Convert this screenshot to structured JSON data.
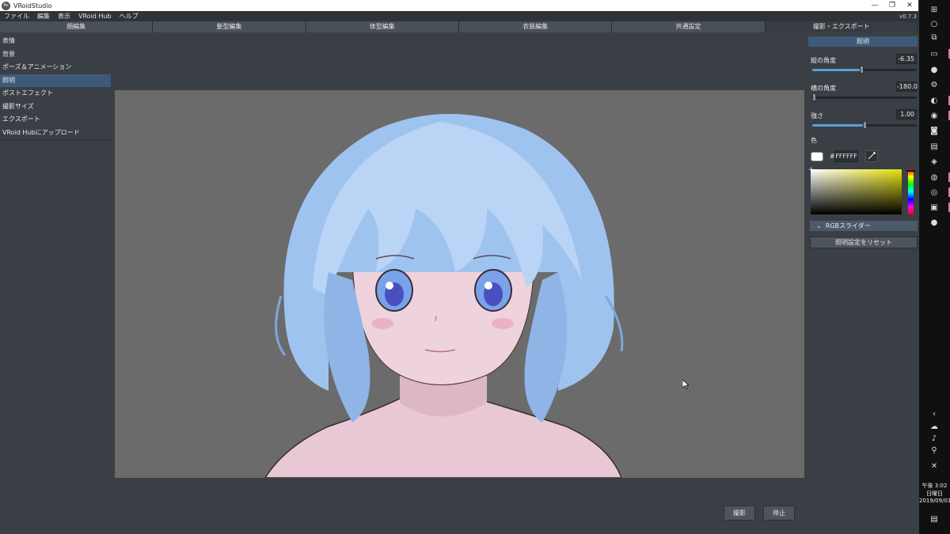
{
  "window": {
    "logo_text": "Ro",
    "title": "VRoidStudio",
    "minimize": "—",
    "maximize": "❐",
    "close": "✕",
    "version": "v0.7.3"
  },
  "menu": [
    "ファイル",
    "編集",
    "表示",
    "VRoid Hub",
    "ヘルプ"
  ],
  "tabs": [
    {
      "label": "顔編集",
      "active": false
    },
    {
      "label": "髪型編集",
      "active": false
    },
    {
      "label": "体型編集",
      "active": false
    },
    {
      "label": "衣装編集",
      "active": false
    },
    {
      "label": "共通設定",
      "active": false
    },
    {
      "label": "撮影・エクスポート",
      "active": true
    }
  ],
  "sidebar": {
    "items": [
      {
        "label": "表情",
        "active": false
      },
      {
        "label": "背景",
        "active": false
      },
      {
        "label": "ポーズ＆アニメーション",
        "active": false
      },
      {
        "label": "照明",
        "active": true
      },
      {
        "label": "ポストエフェクト",
        "active": false
      },
      {
        "label": "撮影サイズ",
        "active": false
      },
      {
        "label": "エクスポート",
        "active": false
      },
      {
        "label": "VRoid Hubにアップロード",
        "active": false
      }
    ]
  },
  "viewport": {
    "shoot_button": "撮影",
    "stop_button": "停止"
  },
  "lighting": {
    "header": "照明",
    "vertical_angle": {
      "label": "縦の角度",
      "value": "-6.35",
      "fraction": 0.47
    },
    "horizontal_angle": {
      "label": "横の角度",
      "value": "-180.0",
      "fraction": 0.0
    },
    "intensity": {
      "label": "強さ",
      "value": "1.00",
      "fraction": 0.5
    },
    "color_label": "色",
    "hex_prefix": "#",
    "hex_value": "FFFFFF",
    "color": "#FFFFFF",
    "rgb_slider_label": "RGBスライダー",
    "reset_button": "照明設定をリセット"
  },
  "taskbar": {
    "time": "午後 3:02",
    "weekday": "日曜日",
    "date": "2019/09/01",
    "accent_color": "#e36fc4"
  }
}
